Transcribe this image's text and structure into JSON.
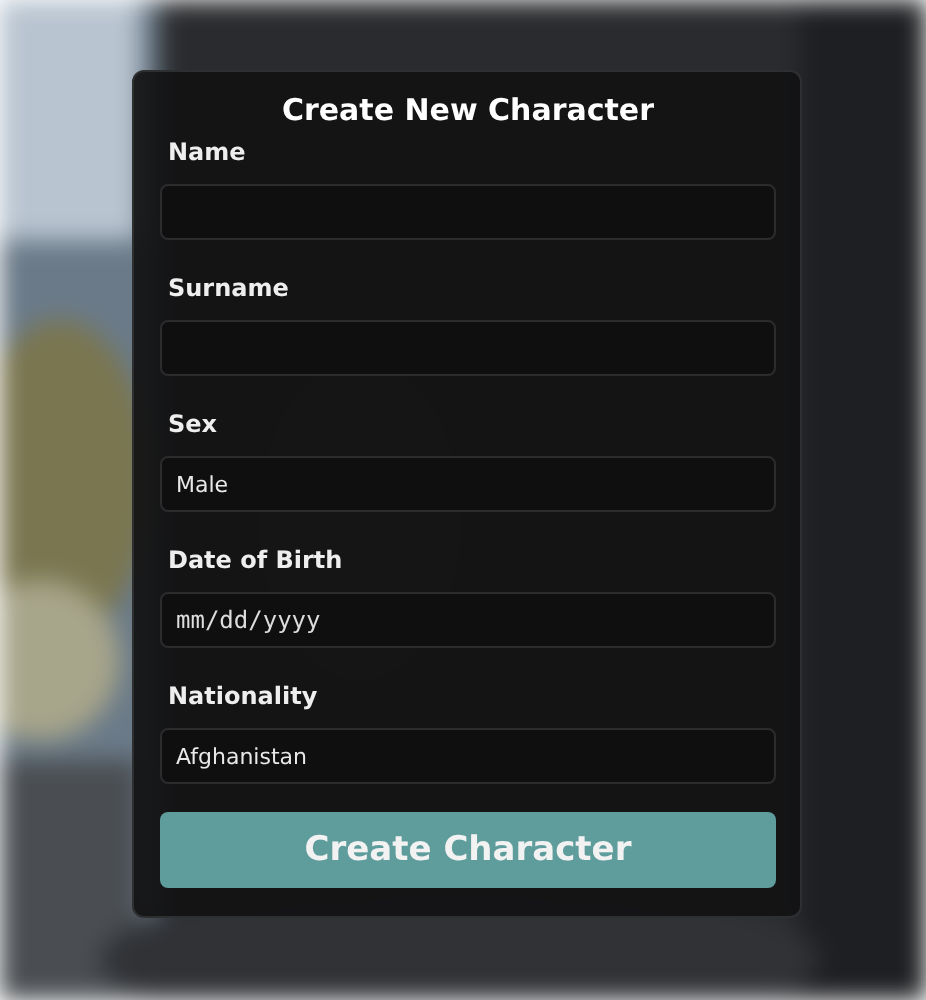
{
  "form": {
    "title": "Create New Character",
    "fields": [
      {
        "label": "Name",
        "kind": "text"
      },
      {
        "label": "Surname",
        "kind": "text"
      },
      {
        "label": "Sex",
        "kind": "select",
        "value": "Male"
      },
      {
        "label": "Date of Birth",
        "kind": "date",
        "placeholder": "mm/dd/yyyy"
      },
      {
        "label": "Nationality",
        "kind": "select",
        "value": "Afghanistan"
      }
    ],
    "submit": "Create Character"
  }
}
